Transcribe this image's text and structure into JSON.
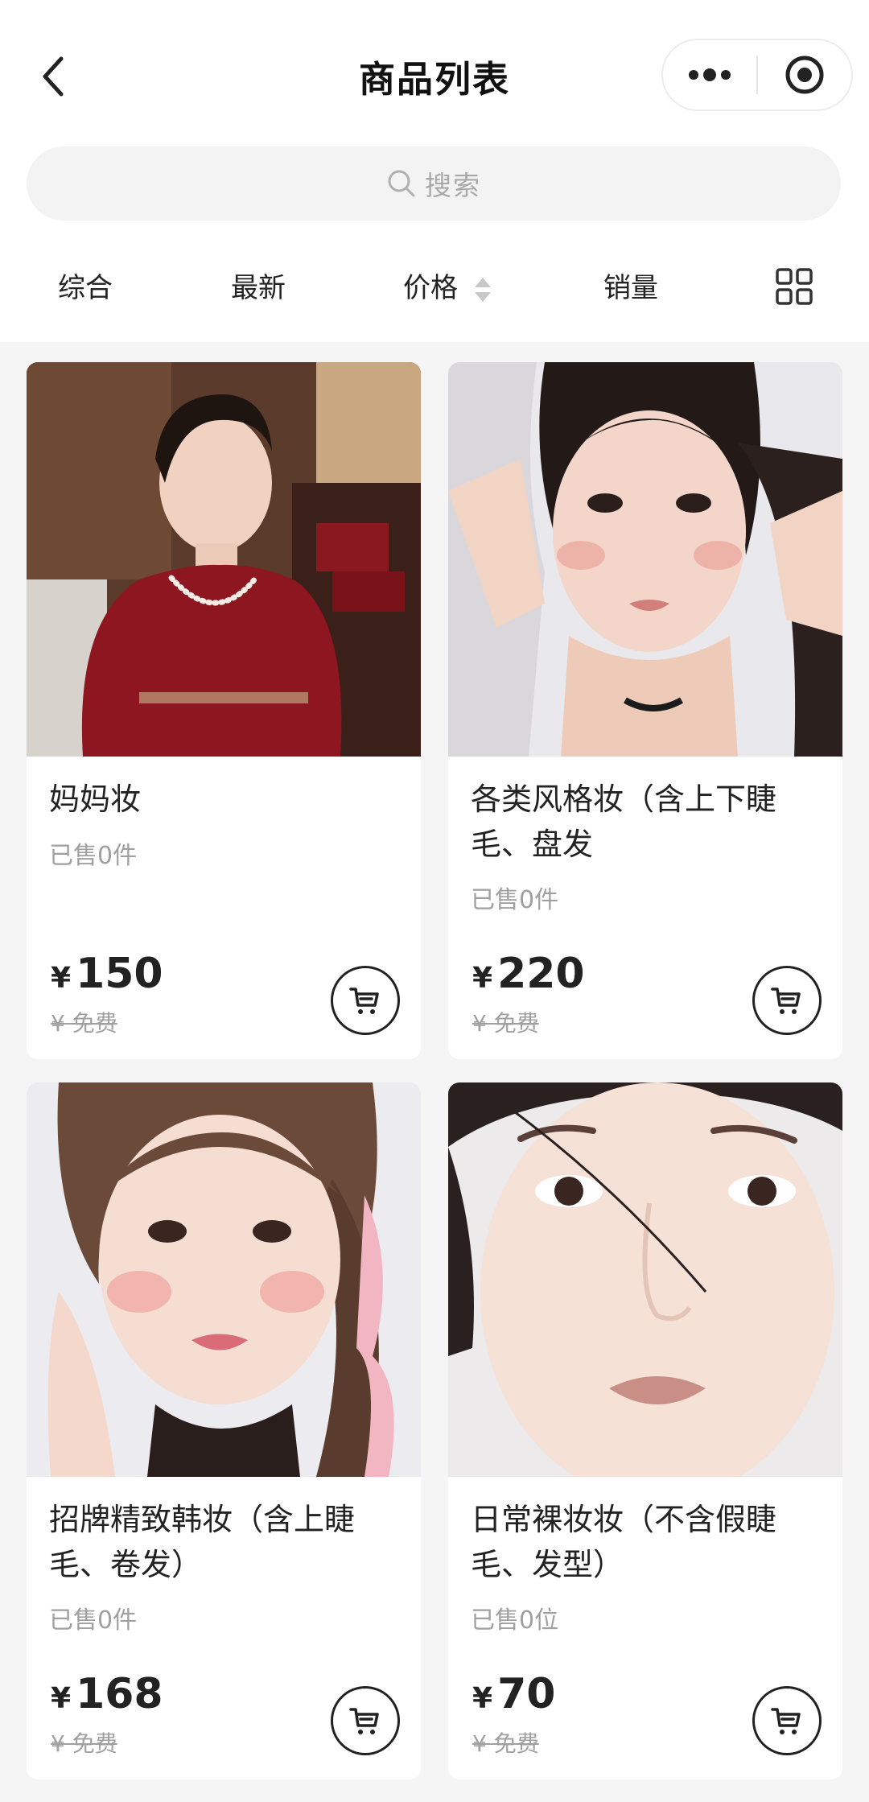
{
  "nav": {
    "title": "商品列表"
  },
  "search": {
    "placeholder": "搜索"
  },
  "sort": {
    "items": [
      "综合",
      "最新",
      "价格",
      "销量"
    ]
  },
  "products": [
    {
      "title": "妈妈妆",
      "sold": "已售0件",
      "currency": "¥",
      "price": "150",
      "original": "¥ 免费"
    },
    {
      "title": "各类风格妆（含上下睫毛、盘发",
      "sold": "已售0件",
      "currency": "¥",
      "price": "220",
      "original": "¥ 免费"
    },
    {
      "title": "招牌精致韩妆（含上睫毛、卷发）",
      "sold": "已售0件",
      "currency": "¥",
      "price": "168",
      "original": "¥ 免费"
    },
    {
      "title": "日常裸妆妆（不含假睫毛、发型）",
      "sold": "已售0位",
      "currency": "¥",
      "price": "70",
      "original": "¥ 免费"
    }
  ],
  "icons": [
    "back-icon",
    "more-icon",
    "target-icon",
    "search-icon",
    "sort-arrows-icon",
    "grid-layout-icon",
    "cart-icon"
  ]
}
